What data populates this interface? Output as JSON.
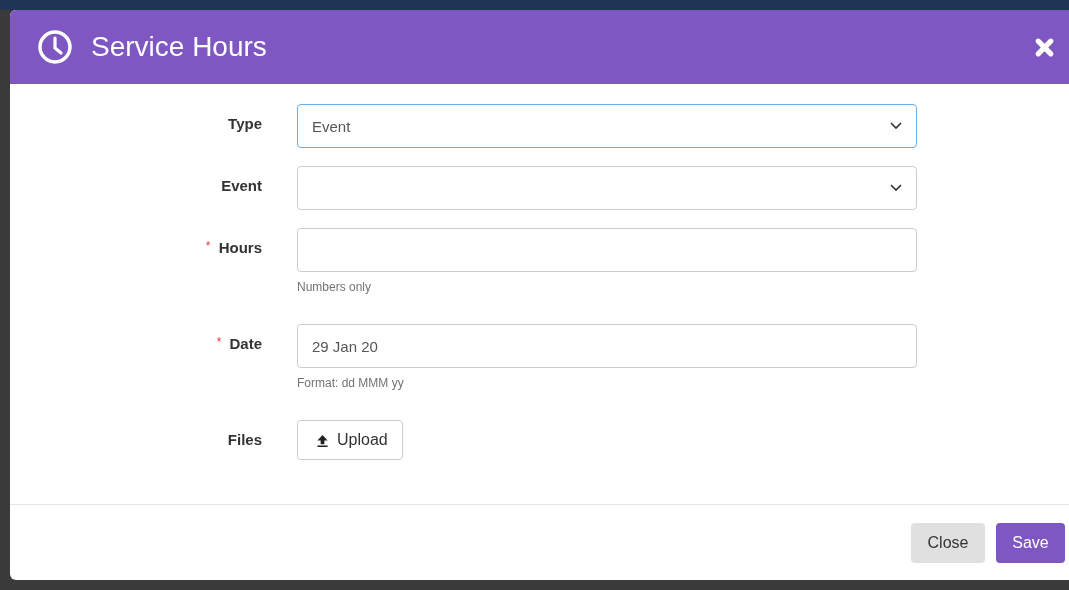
{
  "dialog": {
    "title": "Service Hours"
  },
  "fields": [
    {
      "kind": "select",
      "label": "Type",
      "focused": true,
      "value": "Event"
    },
    {
      "kind": "select",
      "label": "Event",
      "focused": false
    },
    {
      "kind": "text",
      "label": "Hours",
      "required_mark": "*",
      "focused": false,
      "help": "Numbers only"
    },
    {
      "kind": "text",
      "label": "Date",
      "required_mark": "*",
      "focused": false,
      "value": "29 Jan 20",
      "help": "Format: dd MMM yy"
    },
    {
      "kind": "upload",
      "label": "Files",
      "button": "Upload"
    }
  ],
  "buttons": [
    {
      "label": "Close",
      "kind": "secondary"
    },
    {
      "label": "Save",
      "kind": "primary"
    }
  ]
}
